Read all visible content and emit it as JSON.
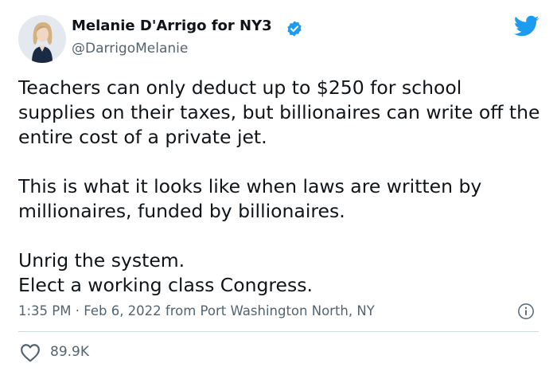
{
  "tweet": {
    "display_name": "Melanie D'Arrigo for NY3",
    "handle": "@DarrigoMelanie",
    "paragraphs": [
      "Teachers can only deduct up to $250 for school supplies on their taxes, but billionaires can write off the entire cost of a private jet.",
      "This is what it looks like when laws are written by millionaires, funded by billionaires.",
      "Unrig the system."
    ],
    "last_line": "Elect a working class Congress.",
    "time": "1:35 PM",
    "separator": "·",
    "date_location": "Feb 6, 2022 from Port Washington North, NY",
    "likes": "89.9K"
  },
  "colors": {
    "twitter_blue": "#1d9bf0",
    "text_primary": "#0f1419",
    "text_secondary": "#536471",
    "divider": "#cfd9de"
  },
  "icons": {
    "verified": "verified-badge-icon",
    "brand": "twitter-bird-icon",
    "info": "info-icon",
    "like": "heart-icon"
  }
}
